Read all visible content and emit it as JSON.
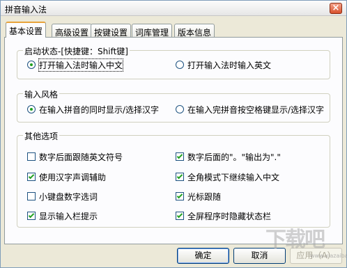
{
  "window": {
    "title": "拼音输入法",
    "close_glyph": "×"
  },
  "tabs": [
    {
      "label": "基本设置",
      "active": true
    },
    {
      "label": "高级设置",
      "active": false
    },
    {
      "label": "按键设置",
      "active": false
    },
    {
      "label": "词库管理",
      "active": false
    },
    {
      "label": "版本信息",
      "active": false
    }
  ],
  "startup_group": {
    "title": "启动状态-[快捷键：Shift键]",
    "options": [
      {
        "label": "打开输入法时输入中文",
        "selected": true
      },
      {
        "label": "打开输入法时输入英文",
        "selected": false
      }
    ]
  },
  "style_group": {
    "title": "输入风格",
    "options": [
      {
        "label": "在输入拼音的同时显示/选择汉字",
        "selected": true
      },
      {
        "label": "在输入完拼音按空格键显示/选择汉字",
        "selected": false
      }
    ]
  },
  "other_group": {
    "title": "其他选项",
    "options": [
      {
        "label": "数字后面跟随英文符号",
        "checked": false
      },
      {
        "label": "数字后面的\"。\"输出为\".\"",
        "checked": true
      },
      {
        "label": "使用汉字声调辅助",
        "checked": true
      },
      {
        "label": "全角模式下继续输入中文",
        "checked": true
      },
      {
        "label": "小键盘数字选词",
        "checked": false
      },
      {
        "label": "光标跟随",
        "checked": true
      },
      {
        "label": "显示输入栏提示",
        "checked": true
      },
      {
        "label": "全屏程序时隐藏状态栏",
        "checked": true
      }
    ]
  },
  "buttons": {
    "ok": "确定",
    "cancel": "取消",
    "apply": "应用（A）"
  },
  "watermark": {
    "text": "下载吧",
    "url": "www.xiazaiba.com"
  },
  "colors": {
    "accent": "#21a121",
    "tab_highlight": "#e8a33a",
    "border": "#919b9c"
  }
}
